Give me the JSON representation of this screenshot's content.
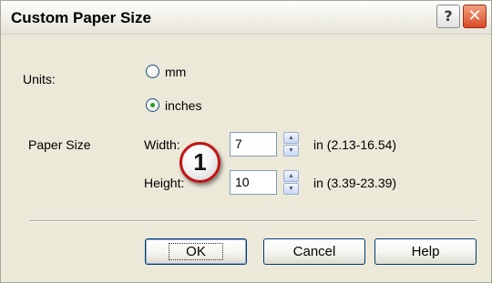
{
  "window": {
    "title": "Custom Paper Size",
    "help_button": "?",
    "close_button": "✕"
  },
  "units": {
    "label": "Units:",
    "options": [
      {
        "label": "mm",
        "selected": false
      },
      {
        "label": "inches",
        "selected": true
      }
    ]
  },
  "paper_size": {
    "label": "Paper Size",
    "width": {
      "label": "Width:",
      "value": "7",
      "range": "in (2.13-16.54)"
    },
    "height": {
      "label": "Height:",
      "value": "10",
      "range": "in (3.39-23.39)"
    }
  },
  "buttons": {
    "ok": "OK",
    "cancel": "Cancel",
    "help": "Help"
  },
  "callout": "1",
  "colors": {
    "dialog_bg": "#ECE9D8",
    "close_red": "#D94A25",
    "radio_dot": "#21A121",
    "callout_ring": "#C01616"
  }
}
